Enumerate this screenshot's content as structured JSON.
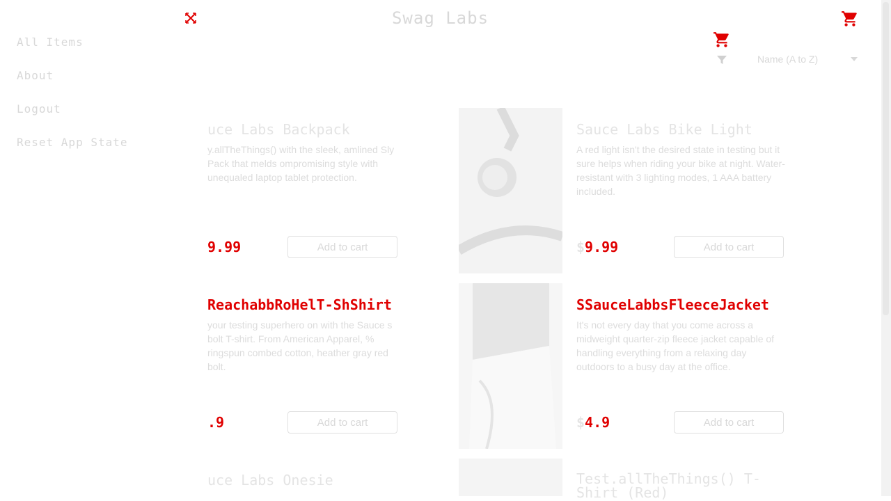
{
  "header": {
    "title": "Swag Labs"
  },
  "sort": {
    "label": "Name (A to Z)"
  },
  "menu": {
    "items": [
      "All Items",
      "About",
      "Logout",
      "Reset App State"
    ]
  },
  "products": [
    {
      "name": "uce Labs Backpack",
      "desc": "y.allTheThings() with the sleek, amlined Sly Pack that melds ompromising style with unequaled laptop tablet protection.",
      "price": "9.99",
      "price_prefix": "",
      "button": "Add to cart"
    },
    {
      "name": "Sauce Labs Bike Light",
      "desc": "A red light isn't the desired state in testing but it sure helps when riding your bike at night. Water-resistant with 3 lighting modes, 1 AAA battery included.",
      "price": "9.99",
      "price_prefix": "$",
      "button": "Add to cart"
    },
    {
      "name": "ReachabbRoHelT-ShShirt",
      "desc": "your testing superhero on with the Sauce s bolt T-shirt. From American Apparel, % ringspun combed cotton, heather gray red bolt.",
      "price": ".9",
      "price_prefix": "",
      "button": "Add to cart"
    },
    {
      "name": "SSauceLabbsFleeceJacket",
      "desc": "It's not every day that you come across a midweight quarter-zip fleece jacket capable of handling everything from a relaxing day outdoors to a busy day at the office.",
      "price": "4.9",
      "price_prefix": "$",
      "button": "Add to cart"
    },
    {
      "name": "uce Labs Onesie"
    },
    {
      "name": "Test.allTheThings() T-Shirt (Red)"
    }
  ]
}
